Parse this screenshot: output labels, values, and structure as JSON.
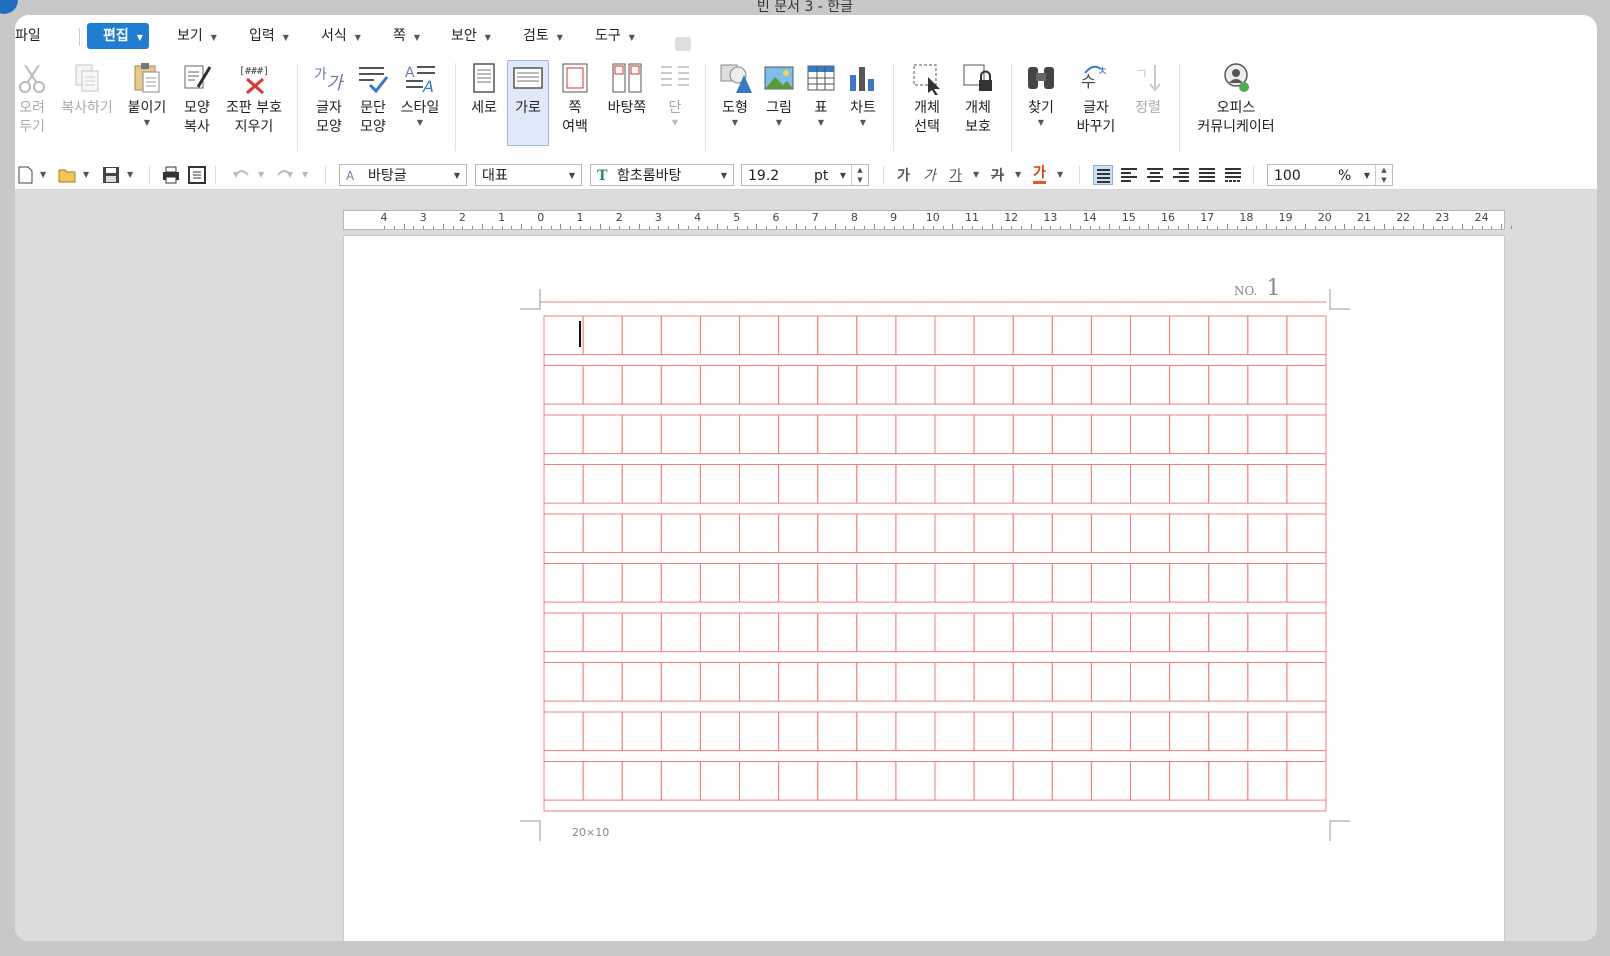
{
  "window": {
    "title": "빈 문서 3 - 한글"
  },
  "menu": {
    "items": [
      {
        "label": "파일"
      },
      {
        "label": "편집",
        "active": true
      },
      {
        "label": "보기"
      },
      {
        "label": "입력"
      },
      {
        "label": "서식"
      },
      {
        "label": "쪽"
      },
      {
        "label": "보안"
      },
      {
        "label": "검토"
      },
      {
        "label": "도구"
      }
    ]
  },
  "ribbon": {
    "cut": {
      "line1": "오려",
      "line2": "두기"
    },
    "copy": {
      "line1": "복사하기"
    },
    "paste": {
      "line1": "붙이기"
    },
    "format_copy": {
      "line1": "모양",
      "line2": "복사"
    },
    "clear_format": {
      "line1": "조판 부호",
      "line2": "지우기"
    },
    "char_shape": {
      "line1": "글자",
      "line2": "모양"
    },
    "para_shape": {
      "line1": "문단",
      "line2": "모양"
    },
    "style": {
      "line1": "스타일"
    },
    "portrait": {
      "line1": "세로"
    },
    "landscape": {
      "line1": "가로"
    },
    "margins": {
      "line1": "쪽",
      "line2": "여백"
    },
    "master_page": {
      "line1": "바탕쪽"
    },
    "columns": {
      "line1": "단"
    },
    "shape": {
      "line1": "도형"
    },
    "picture": {
      "line1": "그림"
    },
    "table": {
      "line1": "표"
    },
    "chart": {
      "line1": "차트"
    },
    "object_select": {
      "line1": "개체",
      "line2": "선택"
    },
    "object_protect": {
      "line1": "개체",
      "line2": "보호"
    },
    "find": {
      "line1": "찾기"
    },
    "replace": {
      "line1": "글자",
      "line2": "바꾸기"
    },
    "sort": {
      "line1": "정렬"
    },
    "office_communicator": {
      "line1": "오피스",
      "line2": "커뮤니케이터"
    }
  },
  "toolbar": {
    "style": "바탕글",
    "language": "대표",
    "font": "함초롬바탕",
    "font_size": "19.2",
    "font_unit": "pt",
    "zoom": "100",
    "zoom_unit": "%",
    "bold": "가",
    "italic": "가",
    "underline": "가",
    "strike": "가",
    "color": "가"
  },
  "ruler": {
    "labels": [
      "4",
      "3",
      "2",
      "1",
      "0",
      "1",
      "2",
      "3",
      "4",
      "5",
      "6",
      "7",
      "8",
      "9",
      "10",
      "11",
      "12",
      "13",
      "14",
      "15",
      "16",
      "17",
      "18",
      "19",
      "20",
      "21",
      "22",
      "23",
      "24"
    ]
  },
  "document": {
    "page_no_label": "NO.",
    "page_no_value": "1",
    "grid_size_label": "20×10",
    "grid_columns": 20,
    "grid_rows": 10,
    "grid_color": "#f08080"
  }
}
